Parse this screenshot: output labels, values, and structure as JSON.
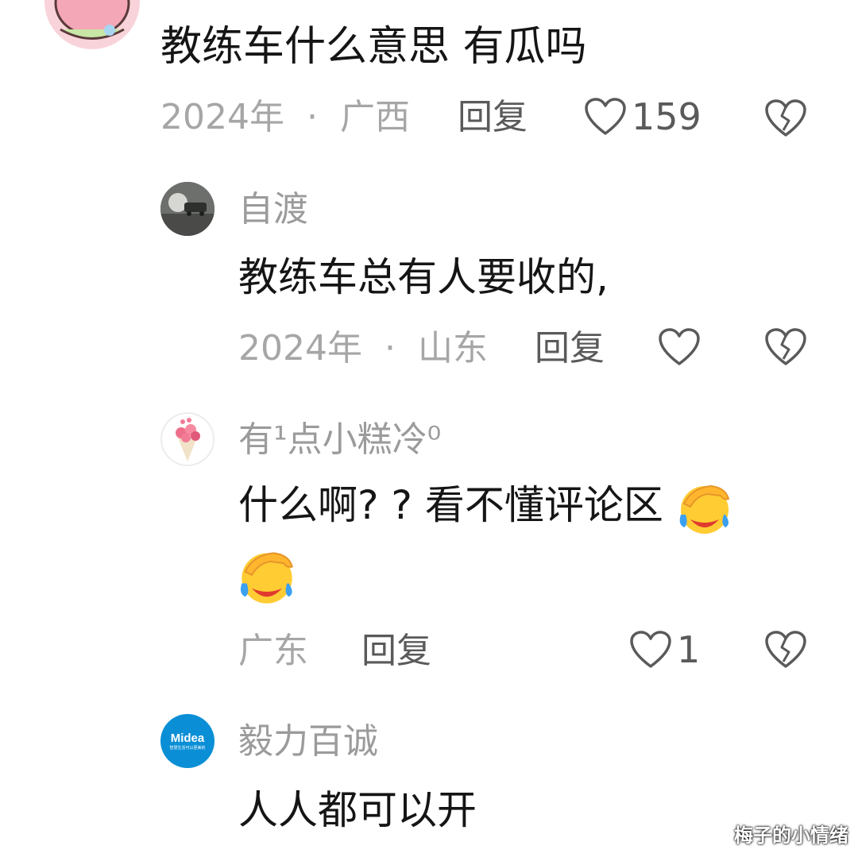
{
  "comments": [
    {
      "content": "教练车什么意思 有瓜吗",
      "time": "2024年",
      "location": "广西",
      "reply_label": "回复",
      "likes": "159"
    },
    {
      "username": "自渡",
      "content": "教练车总有人要收的,",
      "time": "2024年",
      "location": "山东",
      "reply_label": "回复"
    },
    {
      "username": "有¹点小糕冷⁰",
      "content_line1": "什么啊? ? 看不懂评论区",
      "location": "广东",
      "reply_label": "回复",
      "likes": "1"
    },
    {
      "username": "毅力百诚",
      "content": "人人都可以开",
      "avatar_brand": "Midea",
      "avatar_tagline": "智慧生活可以更美的"
    }
  ],
  "meta_separator": "·",
  "watermark": "梅子的小情绪",
  "colors": {
    "meta_gray": "#a6a6a6",
    "username_gray": "#9b9b9b",
    "text": "#151515",
    "midea_blue": "#0a8fd6"
  }
}
